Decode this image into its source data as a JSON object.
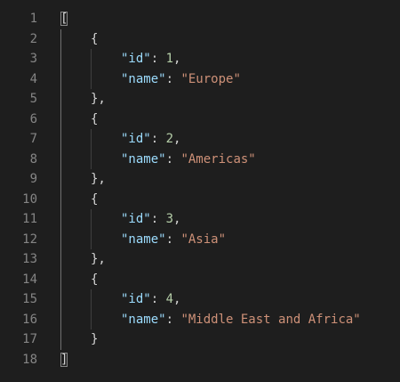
{
  "editor": {
    "theme": {
      "background": "#1e1e1e",
      "line_number_color": "#858585",
      "key_color": "#9cdcfe",
      "string_color": "#ce9178",
      "number_color": "#b5cea8",
      "punctuation_color": "#d4d4d4"
    },
    "lines": [
      {
        "n": "1",
        "indent": 0,
        "tokens": [
          {
            "t": "[",
            "c": "bracket-match"
          }
        ]
      },
      {
        "n": "2",
        "indent": 1,
        "tokens": [
          {
            "t": "{",
            "c": "punc"
          }
        ]
      },
      {
        "n": "3",
        "indent": 2,
        "tokens": [
          {
            "t": "\"id\"",
            "c": "key"
          },
          {
            "t": ": ",
            "c": "punc"
          },
          {
            "t": "1",
            "c": "num"
          },
          {
            "t": ",",
            "c": "punc"
          }
        ]
      },
      {
        "n": "4",
        "indent": 2,
        "tokens": [
          {
            "t": "\"name\"",
            "c": "key"
          },
          {
            "t": ": ",
            "c": "punc"
          },
          {
            "t": "\"Europe\"",
            "c": "str"
          }
        ]
      },
      {
        "n": "5",
        "indent": 1,
        "tokens": [
          {
            "t": "},",
            "c": "punc"
          }
        ]
      },
      {
        "n": "6",
        "indent": 1,
        "tokens": [
          {
            "t": "{",
            "c": "punc"
          }
        ]
      },
      {
        "n": "7",
        "indent": 2,
        "tokens": [
          {
            "t": "\"id\"",
            "c": "key"
          },
          {
            "t": ": ",
            "c": "punc"
          },
          {
            "t": "2",
            "c": "num"
          },
          {
            "t": ",",
            "c": "punc"
          }
        ]
      },
      {
        "n": "8",
        "indent": 2,
        "tokens": [
          {
            "t": "\"name\"",
            "c": "key"
          },
          {
            "t": ": ",
            "c": "punc"
          },
          {
            "t": "\"Americas\"",
            "c": "str"
          }
        ]
      },
      {
        "n": "9",
        "indent": 1,
        "tokens": [
          {
            "t": "},",
            "c": "punc"
          }
        ]
      },
      {
        "n": "10",
        "indent": 1,
        "tokens": [
          {
            "t": "{",
            "c": "punc"
          }
        ]
      },
      {
        "n": "11",
        "indent": 2,
        "tokens": [
          {
            "t": "\"id\"",
            "c": "key"
          },
          {
            "t": ": ",
            "c": "punc"
          },
          {
            "t": "3",
            "c": "num"
          },
          {
            "t": ",",
            "c": "punc"
          }
        ]
      },
      {
        "n": "12",
        "indent": 2,
        "tokens": [
          {
            "t": "\"name\"",
            "c": "key"
          },
          {
            "t": ": ",
            "c": "punc"
          },
          {
            "t": "\"Asia\"",
            "c": "str"
          }
        ]
      },
      {
        "n": "13",
        "indent": 1,
        "tokens": [
          {
            "t": "},",
            "c": "punc"
          }
        ]
      },
      {
        "n": "14",
        "indent": 1,
        "tokens": [
          {
            "t": "{",
            "c": "punc"
          }
        ]
      },
      {
        "n": "15",
        "indent": 2,
        "tokens": [
          {
            "t": "\"id\"",
            "c": "key"
          },
          {
            "t": ": ",
            "c": "punc"
          },
          {
            "t": "4",
            "c": "num"
          },
          {
            "t": ",",
            "c": "punc"
          }
        ]
      },
      {
        "n": "16",
        "indent": 2,
        "tokens": [
          {
            "t": "\"name\"",
            "c": "key"
          },
          {
            "t": ": ",
            "c": "punc"
          },
          {
            "t": "\"Middle East and Africa\"",
            "c": "str"
          }
        ]
      },
      {
        "n": "17",
        "indent": 1,
        "tokens": [
          {
            "t": "}",
            "c": "punc"
          }
        ]
      },
      {
        "n": "18",
        "indent": 0,
        "tokens": [
          {
            "t": "]",
            "c": "bracket-match"
          }
        ]
      }
    ]
  }
}
